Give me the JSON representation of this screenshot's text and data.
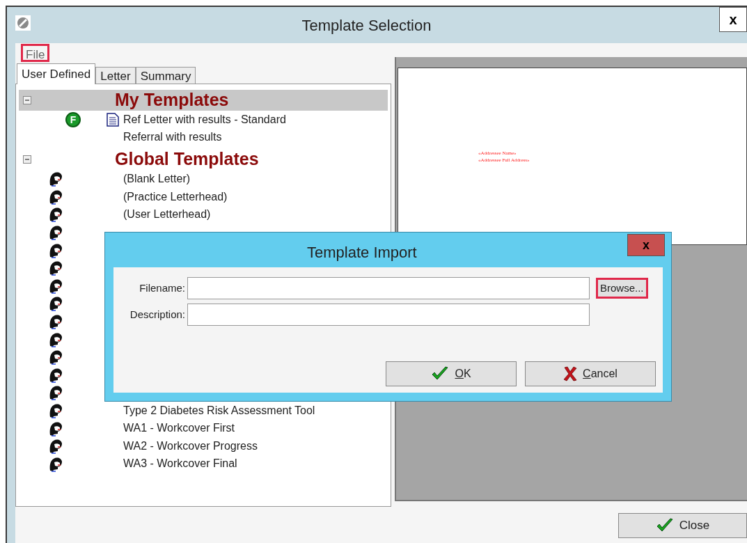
{
  "window": {
    "title": "Template Selection",
    "close": "x"
  },
  "menu": [
    {
      "label": "File",
      "highlighted": true
    }
  ],
  "tabs": [
    {
      "label": "User Defined",
      "selected": true
    },
    {
      "label": "Letter",
      "selected": false
    },
    {
      "label": "Summary",
      "selected": false
    }
  ],
  "tree": [
    {
      "label": "My Templates",
      "expanded": true,
      "selected": true,
      "children": [
        {
          "label": "Ref Letter with results - Standard",
          "badge": "F",
          "kind": "document"
        },
        {
          "label": "Referral with results",
          "kind": "plain"
        }
      ]
    },
    {
      "label": "Global Templates",
      "expanded": true,
      "selected": false,
      "children": [
        {
          "kind": "person",
          "label": "(Blank Letter)"
        },
        {
          "kind": "person",
          "label": "(Practice Letterhead)"
        },
        {
          "kind": "person",
          "label": "(User Letterhead)"
        },
        {
          "kind": "person"
        },
        {
          "kind": "person"
        },
        {
          "kind": "person"
        },
        {
          "kind": "person"
        },
        {
          "kind": "person"
        },
        {
          "kind": "person"
        },
        {
          "kind": "person"
        },
        {
          "kind": "person"
        },
        {
          "kind": "person"
        },
        {
          "kind": "person"
        },
        {
          "kind": "person",
          "label": "Type 2 Diabetes Risk Assessment Tool"
        },
        {
          "kind": "person",
          "label": "WA1 - Workcover First"
        },
        {
          "kind": "person",
          "label": "WA2 - Workcover Progress"
        },
        {
          "kind": "person",
          "label": "WA3 - Workcover Final"
        }
      ]
    }
  ],
  "preview": {
    "lines": [
      "«Addressee Name»",
      "«Addressee Full Address»"
    ]
  },
  "close_button": {
    "label": "Close"
  },
  "dialog": {
    "title": "Template Import",
    "close": "x",
    "fields": [
      {
        "label": "Filename:"
      },
      {
        "label": "Description:"
      }
    ],
    "browse": {
      "label": "Browse...",
      "highlighted": true
    },
    "buttons": [
      {
        "label": "OK",
        "kind": "ok",
        "mnemonic": true
      },
      {
        "label": "Cancel",
        "kind": "cancel",
        "mnemonic": true
      }
    ]
  }
}
